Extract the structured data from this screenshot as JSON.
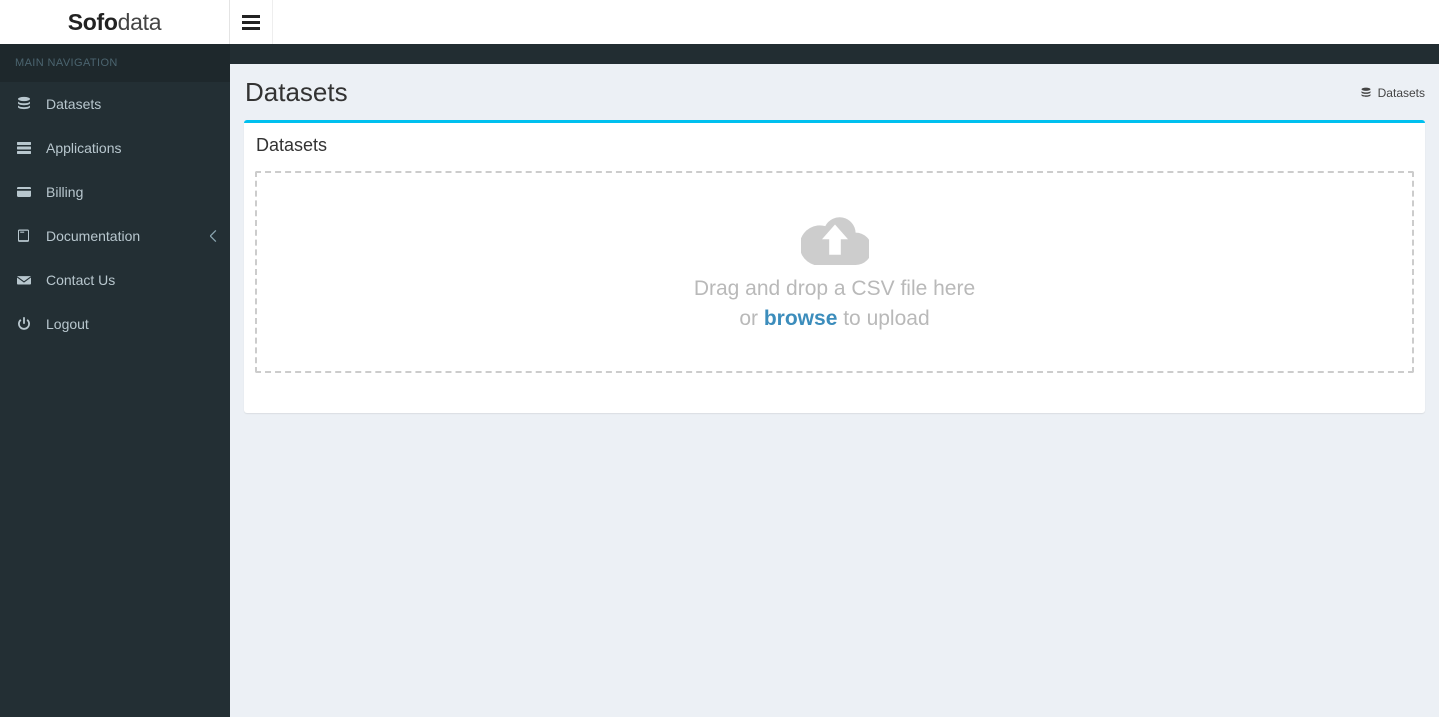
{
  "brand": {
    "logo_strong": "Sofo",
    "logo_light": "data"
  },
  "sidebar": {
    "nav_header": "MAIN NAVIGATION",
    "items": [
      {
        "label": "Datasets",
        "icon": "database-icon"
      },
      {
        "label": "Applications",
        "icon": "server-icon"
      },
      {
        "label": "Billing",
        "icon": "credit-card-icon"
      },
      {
        "label": "Documentation",
        "icon": "book-icon",
        "chevron": "chevron-left-icon"
      },
      {
        "label": "Contact Us",
        "icon": "envelope-icon"
      },
      {
        "label": "Logout",
        "icon": "power-icon"
      }
    ]
  },
  "navbar": {
    "toggle_icon": "hamburger-icon"
  },
  "content": {
    "page_title": "Datasets",
    "breadcrumb": {
      "icon": "database-icon",
      "label": "Datasets"
    },
    "box": {
      "title": "Datasets",
      "accent_color": "#00c0ef",
      "dropzone": {
        "icon": "cloud-upload-icon",
        "line1": "Drag and drop a CSV file here",
        "line2_before": "or ",
        "line2_link": "browse",
        "line2_after": " to upload"
      }
    }
  }
}
